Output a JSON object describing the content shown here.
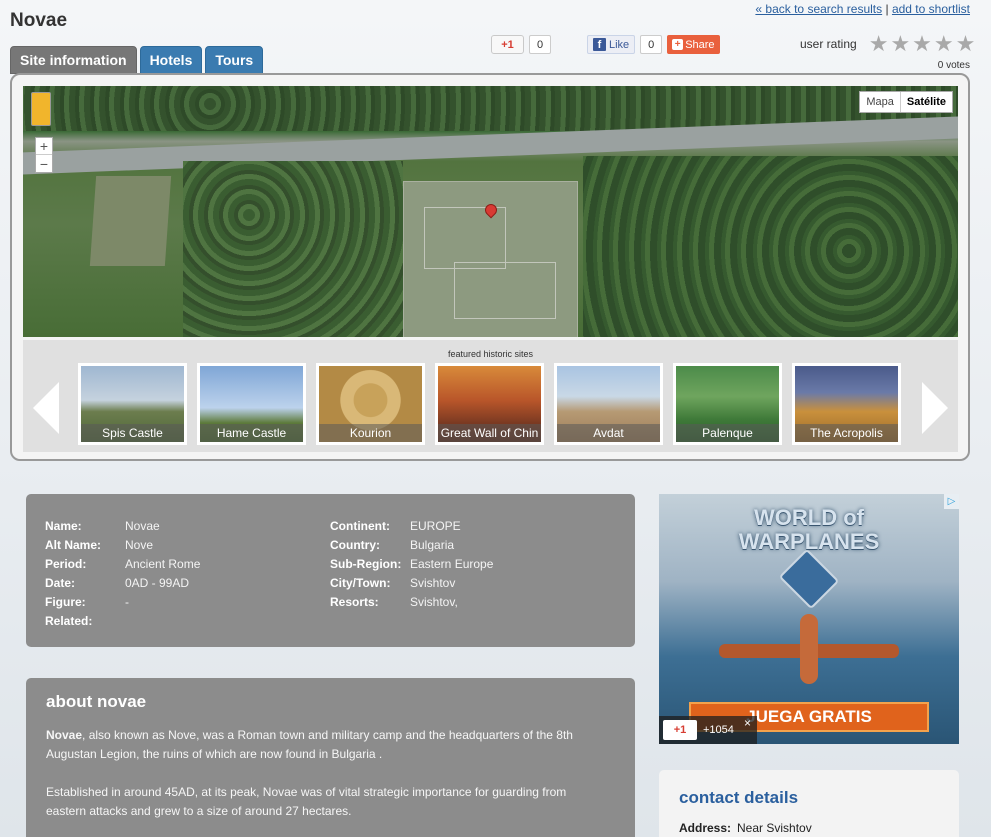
{
  "page": {
    "title": "Novae"
  },
  "top_links": {
    "back": "« back to search results",
    "separator": "|",
    "shortlist": "add to shortlist"
  },
  "tabs": [
    {
      "label": "Site information",
      "active": true
    },
    {
      "label": "Hotels",
      "active": false
    },
    {
      "label": "Tours",
      "active": false
    }
  ],
  "social": {
    "gplus_label": "+1",
    "gplus_count": "0",
    "fb_like_label": "Like",
    "fb_count": "0",
    "share_label": "Share"
  },
  "rating": {
    "label": "user rating",
    "stars_total": 5,
    "stars_filled": 0,
    "votes": "0 votes"
  },
  "map": {
    "type_options": [
      "Mapa",
      "Satélite"
    ],
    "selected_type": "Satélite",
    "zoom_in": "+",
    "zoom_out": "−"
  },
  "carousel": {
    "title": "featured historic sites",
    "items": [
      "Spis Castle",
      "Hame Castle",
      "Kourion",
      "Great Wall of Chin",
      "Avdat",
      "Palenque",
      "The Acropolis"
    ]
  },
  "info": {
    "left": [
      {
        "key": "Name:",
        "value": "Novae"
      },
      {
        "key": "Alt Name:",
        "value": "Nove"
      },
      {
        "key": "Period:",
        "value": "Ancient Rome"
      },
      {
        "key": "Date:",
        "value": "0AD - 99AD"
      },
      {
        "key": "Figure:",
        "value": " -"
      },
      {
        "key": "Related:",
        "value": ""
      }
    ],
    "right": [
      {
        "key": "Continent:",
        "value": "EUROPE"
      },
      {
        "key": "Country:",
        "value": "Bulgaria"
      },
      {
        "key": "Sub-Region:",
        "value": "Eastern Europe"
      },
      {
        "key": "City/Town:",
        "value": "Svishtov"
      },
      {
        "key": "Resorts:",
        "value": "Svishtov,"
      }
    ]
  },
  "about": {
    "title": "about novae",
    "p1_bold": "Novae",
    "p1_rest": ", also known as Nove, was a Roman town and military camp and the headquarters of the 8th Augustan Legion, the ruins of which are now found in Bulgaria .",
    "p2": "Established in around 45AD, at its peak, Novae was of vital strategic importance for guarding from eastern attacks and grew to a size of around 27 hectares."
  },
  "ad": {
    "logo_line1": "WORLD of",
    "logo_line2": "WARPLANES",
    "cta": "JUEGA GRATIS",
    "gplus_label": "+1",
    "gplus_count": "+1054",
    "close": "×",
    "choice_icon": "▷"
  },
  "contact": {
    "title": "contact details",
    "address_label": "Address:",
    "address_value": "Near Svishtov"
  },
  "colors": {
    "tab_blue": "#3a7bb0",
    "tab_active": "#777777",
    "link": "#2a5f9e",
    "info_bg": "#8c8c8c"
  }
}
